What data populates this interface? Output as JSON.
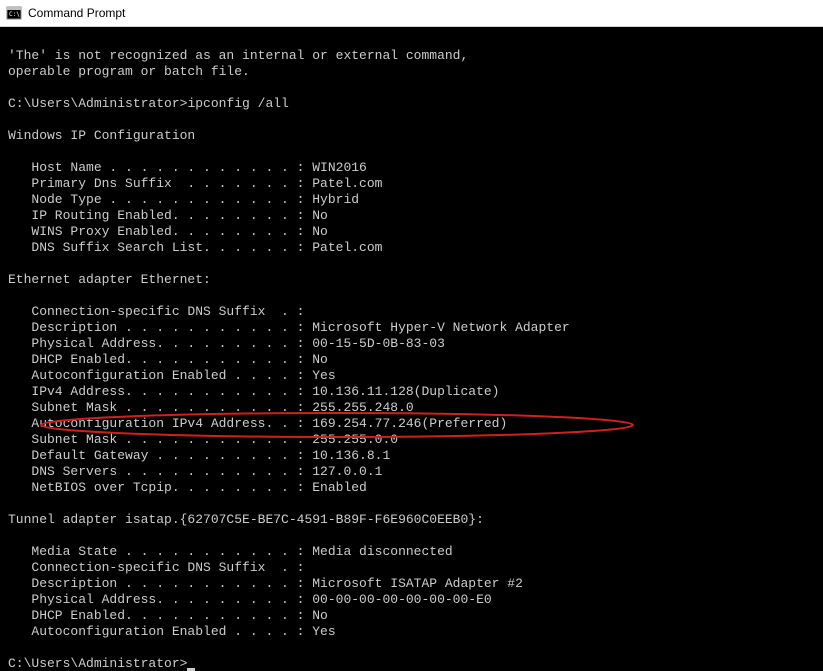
{
  "window": {
    "title": "Command Prompt"
  },
  "terminal": {
    "error_line1": "'The' is not recognized as an internal or external command,",
    "error_line2": "operable program or batch file.",
    "prompt1": "C:\\Users\\Administrator>",
    "command1": "ipconfig /all",
    "ipconfig_header": "Windows IP Configuration",
    "host_name": "   Host Name . . . . . . . . . . . . : WIN2016",
    "primary_dns_suffix": "   Primary Dns Suffix  . . . . . . . : Patel.com",
    "node_type": "   Node Type . . . . . . . . . . . . : Hybrid",
    "ip_routing": "   IP Routing Enabled. . . . . . . . : No",
    "wins_proxy": "   WINS Proxy Enabled. . . . . . . . : No",
    "dns_suffix_list": "   DNS Suffix Search List. . . . . . : Patel.com",
    "ethernet_header": "Ethernet adapter Ethernet:",
    "eth_conn_suffix": "   Connection-specific DNS Suffix  . :",
    "eth_description": "   Description . . . . . . . . . . . : Microsoft Hyper-V Network Adapter",
    "eth_physical": "   Physical Address. . . . . . . . . : 00-15-5D-0B-83-03",
    "eth_dhcp": "   DHCP Enabled. . . . . . . . . . . : No",
    "eth_autoconf_enabled": "   Autoconfiguration Enabled . . . . : Yes",
    "eth_ipv4": "   IPv4 Address. . . . . . . . . . . : 10.136.11.128(Duplicate)",
    "eth_subnet1": "   Subnet Mask . . . . . . . . . . . : 255.255.248.0",
    "eth_autoconf_ipv4": "   Autoconfiguration IPv4 Address. . : 169.254.77.246(Preferred)",
    "eth_subnet2": "   Subnet Mask . . . . . . . . . . . : 255.255.0.0",
    "eth_gateway": "   Default Gateway . . . . . . . . . : 10.136.8.1",
    "eth_dns": "   DNS Servers . . . . . . . . . . . : 127.0.0.1",
    "eth_netbios": "   NetBIOS over Tcpip. . . . . . . . : Enabled",
    "tunnel_header": "Tunnel adapter isatap.{62707C5E-BE7C-4591-B89F-F6E960C0EEB0}:",
    "tun_media": "   Media State . . . . . . . . . . . : Media disconnected",
    "tun_conn_suffix": "   Connection-specific DNS Suffix  . :",
    "tun_description": "   Description . . . . . . . . . . . : Microsoft ISATAP Adapter #2",
    "tun_physical": "   Physical Address. . . . . . . . . : 00-00-00-00-00-00-00-E0",
    "tun_dhcp": "   DHCP Enabled. . . . . . . . . . . : No",
    "tun_autoconf": "   Autoconfiguration Enabled . . . . : Yes",
    "prompt2": "C:\\Users\\Administrator>"
  },
  "highlight": {
    "color": "#d02020"
  }
}
